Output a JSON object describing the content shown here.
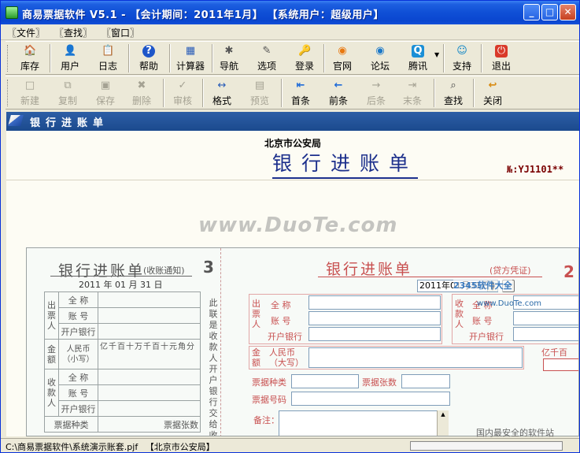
{
  "window": {
    "title": "商易票据软件 V5.1 - 【会计期间：2011年1月】 【系统用户：超级用户】",
    "controls": [
      "_",
      "□",
      "✕"
    ]
  },
  "menu": {
    "file": "〖文件〗",
    "find": "〖查找〗",
    "window": "〖窗口〗"
  },
  "toolbar1": {
    "items": [
      {
        "label": "库存",
        "icon": "🏠"
      },
      {
        "label": "用户",
        "icon": "👤"
      },
      {
        "label": "日志",
        "icon": "📋"
      },
      {
        "label": "帮助",
        "icon": "?"
      },
      {
        "label": "计算器",
        "icon": "▦"
      },
      {
        "label": "导航",
        "icon": "✱"
      },
      {
        "label": "选项",
        "icon": "✎"
      },
      {
        "label": "登录",
        "icon": "🔑"
      },
      {
        "label": "官网",
        "icon": "◉"
      },
      {
        "label": "论坛",
        "icon": "◉"
      },
      {
        "label": "腾讯",
        "icon": "Q"
      },
      {
        "label": "支持",
        "icon": "☺"
      },
      {
        "label": "退出",
        "icon": "⏻"
      }
    ]
  },
  "toolbar2": {
    "items": [
      {
        "label": "新建",
        "icon": "□"
      },
      {
        "label": "复制",
        "icon": "⧉"
      },
      {
        "label": "保存",
        "icon": "▣"
      },
      {
        "label": "删除",
        "icon": "✖"
      },
      {
        "label": "审核",
        "icon": "✓"
      },
      {
        "label": "格式",
        "icon": "↔"
      },
      {
        "label": "预览",
        "icon": "▤"
      },
      {
        "label": "首条",
        "icon": "⇤"
      },
      {
        "label": "前条",
        "icon": "←"
      },
      {
        "label": "后条",
        "icon": "→"
      },
      {
        "label": "末条",
        "icon": "⇥"
      },
      {
        "label": "查找",
        "icon": "⌕"
      },
      {
        "label": "关闭",
        "icon": "↩"
      }
    ]
  },
  "panel": {
    "title": "银行进账单",
    "org": "北京市公安局",
    "form_title": "银行进账单",
    "serial": "№:YJ1101**"
  },
  "watermark": "www.DuoTe.com",
  "voucher_left": {
    "title": "银行进账单",
    "subtitle": "(收账通知)",
    "copy_num": "3",
    "date": "2011 年  01 月  31 日",
    "payer": "出 票 人",
    "payee": "收 款 人",
    "amount": "金 额",
    "full_name": "全 称",
    "account": "账 号",
    "bank": "开户银行",
    "rmb": "人民币（小写）",
    "digits": "亿千百十万千百十元角分",
    "bill_type": "票据种类",
    "bill_count": "票据张数",
    "side_note": "此联是收款人开户银行交给收款人的"
  },
  "voucher_right": {
    "title": "银行进账单",
    "subtitle": "(贷方凭证)",
    "copy_num": "2",
    "date_value": "2011年01月31日",
    "date_button": "…",
    "payer": "出票人",
    "payee": "收款人",
    "amount": "金额",
    "full_name": "全 称",
    "account": "账 号",
    "bank": "开户银行",
    "rmb": "人民币（大写）",
    "digits_top": "亿千百",
    "bill_type": "票据种类",
    "bill_count": "票据张数",
    "bill_no": "票据号码",
    "remark": "备注："
  },
  "badges": {
    "brand": "2345软件大全",
    "brand_url": "www.DuoTe.com",
    "safety": "国内最安全的软件站"
  },
  "status": {
    "path": "C:\\商易票据软件\\系统演示账套.pjf",
    "org": "【北京市公安局】"
  }
}
